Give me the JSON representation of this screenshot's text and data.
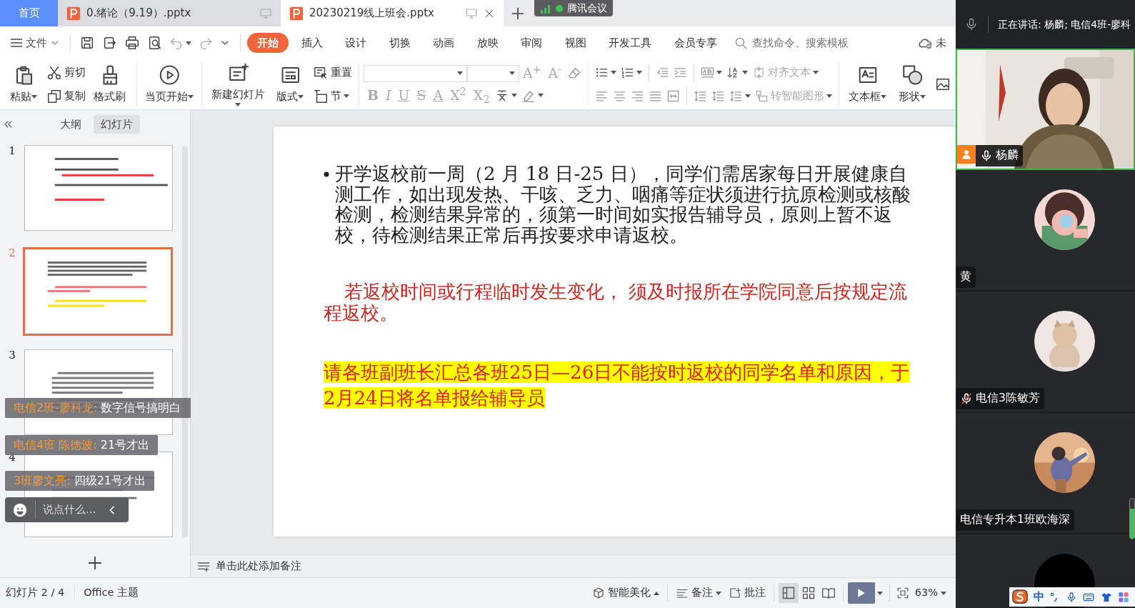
{
  "app_tabs": [
    {
      "label": "首页",
      "kind": "home",
      "selected": false
    },
    {
      "label": "0.绪论（9.19）.pptx",
      "kind": "file",
      "selected": false
    },
    {
      "label": "20230219线上班会.pptx",
      "kind": "file",
      "selected": true
    }
  ],
  "meeting_badge": {
    "label": "腾讯会议"
  },
  "file_menu": "文件",
  "ribbon_tabs": [
    {
      "label": "开始",
      "selected": true
    },
    {
      "label": "插入",
      "selected": false
    },
    {
      "label": "设计",
      "selected": false
    },
    {
      "label": "切换",
      "selected": false
    },
    {
      "label": "动画",
      "selected": false
    },
    {
      "label": "放映",
      "selected": false
    },
    {
      "label": "审阅",
      "selected": false
    },
    {
      "label": "视图",
      "selected": false
    },
    {
      "label": "开发工具",
      "selected": false
    },
    {
      "label": "会员专享",
      "selected": false
    }
  ],
  "search": {
    "placeholder": "查找命令、搜索模板"
  },
  "cloud_status": "未",
  "ribbon_commands": [
    {
      "label": "粘贴",
      "dropdown": true
    },
    {
      "label": "剪切",
      "dropdown": false
    },
    {
      "label": "复制",
      "dropdown": false
    },
    {
      "label": "格式刷",
      "dropdown": false
    },
    {
      "label": "当页开始",
      "dropdown": true
    },
    {
      "label": "新建幻灯片",
      "dropdown": true
    },
    {
      "label": "版式",
      "dropdown": true
    },
    {
      "label": "重置",
      "dropdown": false
    },
    {
      "label": "节",
      "dropdown": true
    },
    {
      "label": "文本框",
      "dropdown": true
    },
    {
      "label": "形状",
      "dropdown": true
    }
  ],
  "font_size_buttons": [
    {
      "label": "A$^{+}$",
      "disabled": true
    },
    {
      "label": "A$^{-}$",
      "disabled": true
    }
  ],
  "format_buttons": [
    {
      "label": "B",
      "disabled": true
    },
    {
      "label": "I",
      "disabled": true
    },
    {
      "label": "U",
      "disabled": true
    },
    {
      "label": "S",
      "disabled": true
    },
    {
      "label": "A",
      "disabled": true
    },
    {
      "label": "X$^{2}$",
      "disabled": true
    },
    {
      "label": "X$_{2}$",
      "disabled": true
    }
  ],
  "paragraph_commands": [
    {
      "label": "对齐文本",
      "disabled": true
    },
    {
      "label": "转智能图形",
      "disabled": true
    }
  ],
  "panel_tabs": [
    {
      "label": "大纲",
      "selected": false
    },
    {
      "label": "幻灯片",
      "selected": true
    }
  ],
  "thumbnails": [
    {
      "number": "1",
      "selected": false
    },
    {
      "number": "2",
      "selected": true
    },
    {
      "number": "3",
      "selected": false
    },
    {
      "number": "4",
      "selected": false
    }
  ],
  "chat": {
    "messages": [
      {
        "sender": "电信2班-廖科龙:",
        "text": "数字信号搞明白"
      },
      {
        "sender": "电信4班 陈德波:",
        "text": "21号才出"
      },
      {
        "sender": "3班廖文亮:",
        "text": "四级21号才出"
      }
    ],
    "input": {
      "placeholder": "说点什么..."
    }
  },
  "slide": {
    "paragraphs": [
      {
        "kind": "bullet",
        "text": "开学返校前一周（2 月 18 日-25 日），同学们需居家每日开展健康自测工作，如出现发热、干咳、乏力、咽痛等症状须进行抗原检测或核酸检测，检测结果异常的，须第一时间如实报告辅导员，原则上暂不返校，待检测结果正常后再按要求申请返校。"
      },
      {
        "kind": "red",
        "text": "若返校时间或行程临时发生变化， 须及时报所在学院同意后按规定流程返校。"
      },
      {
        "kind": "highlight",
        "text": "请各班副班长汇总各班25日—26日不能按时返校的同学名单和原因，于2月24日将名单报给辅导员"
      }
    ]
  },
  "notes_hint": "单击此处添加备注",
  "status_bar": {
    "slide_count": "幻灯片 2 / 4",
    "theme": "Office 主题",
    "beautify": "智能美化",
    "notes": "备注",
    "comments": "批注",
    "views": [
      {
        "selected": true
      },
      {
        "selected": false
      },
      {
        "selected": false
      }
    ],
    "zoom": "63%"
  },
  "meeting": {
    "speaking": "正在讲话: 杨麟; 电信4班-廖科",
    "participants": [
      {
        "name": "杨麟",
        "kind": "video",
        "muted": false
      },
      {
        "name": "黄",
        "kind": "avatar"
      },
      {
        "name": "电信3陈敏芳",
        "kind": "avatar",
        "muted": true
      },
      {
        "name": "电信专升本1班欧海深",
        "kind": "avatar"
      },
      {
        "kind": "blank"
      }
    ],
    "volume": {
      "level": 0.75
    }
  },
  "ime": {
    "mode": "中"
  }
}
